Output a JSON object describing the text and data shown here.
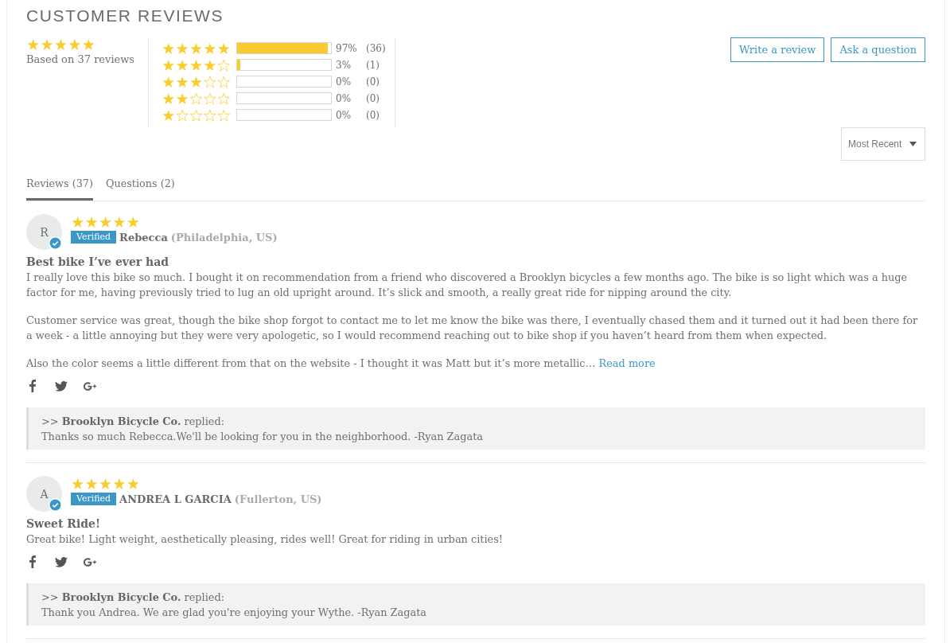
{
  "header": {
    "title": "CUSTOMER REVIEWS"
  },
  "summary": {
    "stars": 5,
    "text": "Based on 37 reviews"
  },
  "histogram": [
    {
      "stars": 5,
      "level": 0.97,
      "percent": "97%",
      "count": "(36)"
    },
    {
      "stars": 4,
      "level": 0.03,
      "percent": "3%",
      "count": "(1)"
    },
    {
      "stars": 3,
      "percent": "0%",
      "count": "(0)"
    },
    {
      "stars": 2,
      "percent": "0%",
      "count": "(0)"
    },
    {
      "stars": 1,
      "percent": "0%",
      "count": "(0)"
    }
  ],
  "actions": [
    "Write a review",
    "Ask a question"
  ],
  "sort": {
    "value": "Most Recent"
  },
  "tabs": [
    {
      "label": "Reviews (37)",
      "selected": true
    },
    {
      "label": "Questions (2)",
      "selected": false
    }
  ],
  "reviews": [
    {
      "initial": "R",
      "stars": 5,
      "badge": "Verified",
      "name": "Rebecca",
      "location": "(Philadelphia, US)",
      "title": "Best bike I’ve ever had",
      "paragraphs": [
        "I really love this bike so much. I bought it on recommendation from a friend who discovered a Brooklyn bicycles a few months ago. The bike is so light which was a huge factor for me, having previously tried to lug an old upright around. It’s slick and smooth, a really great ride for nipping around the city.",
        "Customer service was great, though the bike shop forgot to contact me to let me know the bike was there, I eventually chased them and it turned out it had been there for a week - a little annoying but they were very apologetic, so I would recommend reaching out to bike shop if you haven’t heard from them when expected.",
        "Also the color seems a little different from that on the website - I thought it was Matt but it’s more metallic…"
      ],
      "read_more": "Read more",
      "reply": {
        "header": ">> **Brooklyn Bicycle Co.** replied:",
        "text": "Thanks so much Rebecca.We'll be looking for you in the neighborhood. -Ryan Zagata"
      }
    },
    {
      "initial": "A",
      "stars": 5,
      "badge": "Verified",
      "name": "ANDREA L GARCIA",
      "location": "(Fullerton, US)",
      "title": "Sweet Ride!",
      "paragraphs": [
        "Great bike! Light weight, aesthetically pleasing, rides well! Great for riding in urban cities!"
      ],
      "reply": {
        "header": ">> **Brooklyn Bicycle Co.** replied:",
        "text": "Thank you Andrea. We are glad you're enjoying your Wythe. -Ryan Zagata"
      }
    }
  ]
}
